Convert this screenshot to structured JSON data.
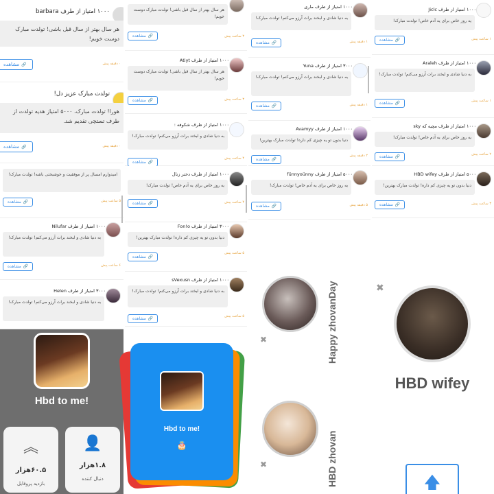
{
  "colors": {
    "accent": "#3a8ee6",
    "card_blue": "#1a8ff0",
    "profile_bg": "#6e6e6e",
    "bubble_bg": "#efefef",
    "time": "#e6a23c"
  },
  "view_label": "مشاهده",
  "col_a": {
    "big_card_1": {
      "header": "۱۰۰۰ امتیاز از طرف barbara",
      "message": "هر سال بهتر از سال قبل باشی! تولدت مبارک دوست خوبم!",
      "time": "۰ دقیقه پیش"
    },
    "big_card_2": {
      "header": "تولدت مبارک عزیز دل!",
      "message": "هورا! تولدت مبارک، ۵۰۰۰ امتیاز هدیه تولدت از طرف تستچی تقدیم شد.",
      "time": "۰ دقیقه پیش"
    },
    "card_3": {
      "message": "امیدوارم امسال پر از موفقیت و خوشبختی باشه! تولدت مبارک!",
      "time": "۵ ساعت پیش"
    },
    "card_4": {
      "header": "۱۰۰۰ امتیاز از طرف Nilufar",
      "message": "به دنیا شادی و لبخند برات آرزو می‌کنم! تولدت مبارک!",
      "time": "۶ ساعت پیش"
    },
    "card_5": {
      "header": "۳۰۰۰ امتیاز از طرف Helen",
      "message": "به دنیا شادی و لبخند برات آرزو می‌کنم! تولدت مبارک!"
    }
  },
  "profile": {
    "name": "Hbd to me!",
    "stat_visits_value": "۶۰.۵هزار",
    "stat_visits_label": "بازدید پروفایل",
    "stat_followers_value": "۱.۸هزار",
    "stat_followers_label": "دنبال کننده"
  },
  "col_b": {
    "card_1": {
      "message": "هر سال بهتر از سال قبل باشی! تولدت مبارک دوست خوبم!",
      "time": "۳ ساعت پیش"
    },
    "card_2": {
      "header": "۱۰۰۰ امتیاز از طرف Atiyt",
      "message": "هر سال بهتر از سال قبل باشی! تولدت مبارک دوست خوبم!",
      "time": "۳ ساعت پیش"
    },
    "card_3": {
      "header": "۱۰۰۰ امتیاز از طرف شکوفه :",
      "message": "به دنیا شادی و لبخند برات آرزو می‌کنم! تولدت مبارک!",
      "time": "۴ ساعت پیش"
    },
    "card_4": {
      "header": "۱۰۰۰ امتیاز از طرف دختر زنال",
      "message": "یه روز خاص برای یه آدم خاص! تولدت مبارک!",
      "time": "۴ ساعت پیش"
    },
    "card_5": {
      "header": "۳۰۰۰ امتیاز از طرف Fon!o",
      "message": "دنیا بدون تو یه چیزی کم داره! تولدت مبارک بهترین!",
      "time": "۵ ساعت پیش"
    },
    "card_6": {
      "header": "۱۰۰۰ امتیاز از طرف sVexusn",
      "message": "به دنیا شادی و لبخند برات آرزو می‌کنم! تولدت مبارک!",
      "time": "۵ ساعت پیش"
    }
  },
  "blue_card": {
    "title": "Hbd to me!",
    "cake": "🎂"
  },
  "col_c": {
    "card_1": {
      "header": "۱۰۰۰ امتیاز از طرف ماری",
      "message": "به دنیا شادی و لبخند برات آرزو می‌کنم! تولدت مبارک!",
      "time": "۱ دقیقه پیش"
    },
    "card_2": {
      "header": "۳۰۰۰ امتیاز از طرف Yuna",
      "message": "به دنیا شادی و لبخند برات آرزو می‌کنم! تولدت مبارک!",
      "time": "۱ دقیقه پیش"
    },
    "card_3": {
      "header": "۱۰۰۰ امتیاز از طرف Avamyy",
      "message": "دنیا بدون تو یه چیزی کم داره! تولدت مبارک بهترین!",
      "time": "۲ دقیقه پیش"
    },
    "card_4": {
      "header": "۵۰۰۰ امتیاز از طرف fünnyoünny",
      "message": "یه روز خاص برای یه آدم خاص! تولدت مبارک!",
      "time": "۵ دقیقه پیش"
    },
    "story_1": "Happy zhovanDay",
    "story_2": "HBD zhovan"
  },
  "col_d": {
    "card_1": {
      "header": "۱۰۰۰ امتیاز از طرف Jiclc",
      "message": "یه روز خاص برای یه آدم خاص! تولدت مبارک!",
      "time": "۱ ساعت پیش"
    },
    "card_2": {
      "header": "۱۰۰۰ امتیاز از طرف Araleh",
      "message": "به دنیا شادی و لبخند برات آرزو می‌کنم! تولدت مبارک!",
      "time": "۱ ساعت پیش"
    },
    "card_3": {
      "header": "۱۰۰۰ امتیاز از طرف مچیه که sky",
      "message": "یه روز خاص برای یه آدم خاص! تولدت مبارک!",
      "time": "۲ ساعت پیش"
    },
    "card_4": {
      "header": "۵۰۰۰ امتیاز از طرف HBD wifey",
      "message": "دنیا بدون تو یه چیزی کم داره! تولدت مبارک بهترین!",
      "time": "۳ ساعت پیش"
    }
  },
  "wifey": {
    "title": "HBD wifey"
  }
}
